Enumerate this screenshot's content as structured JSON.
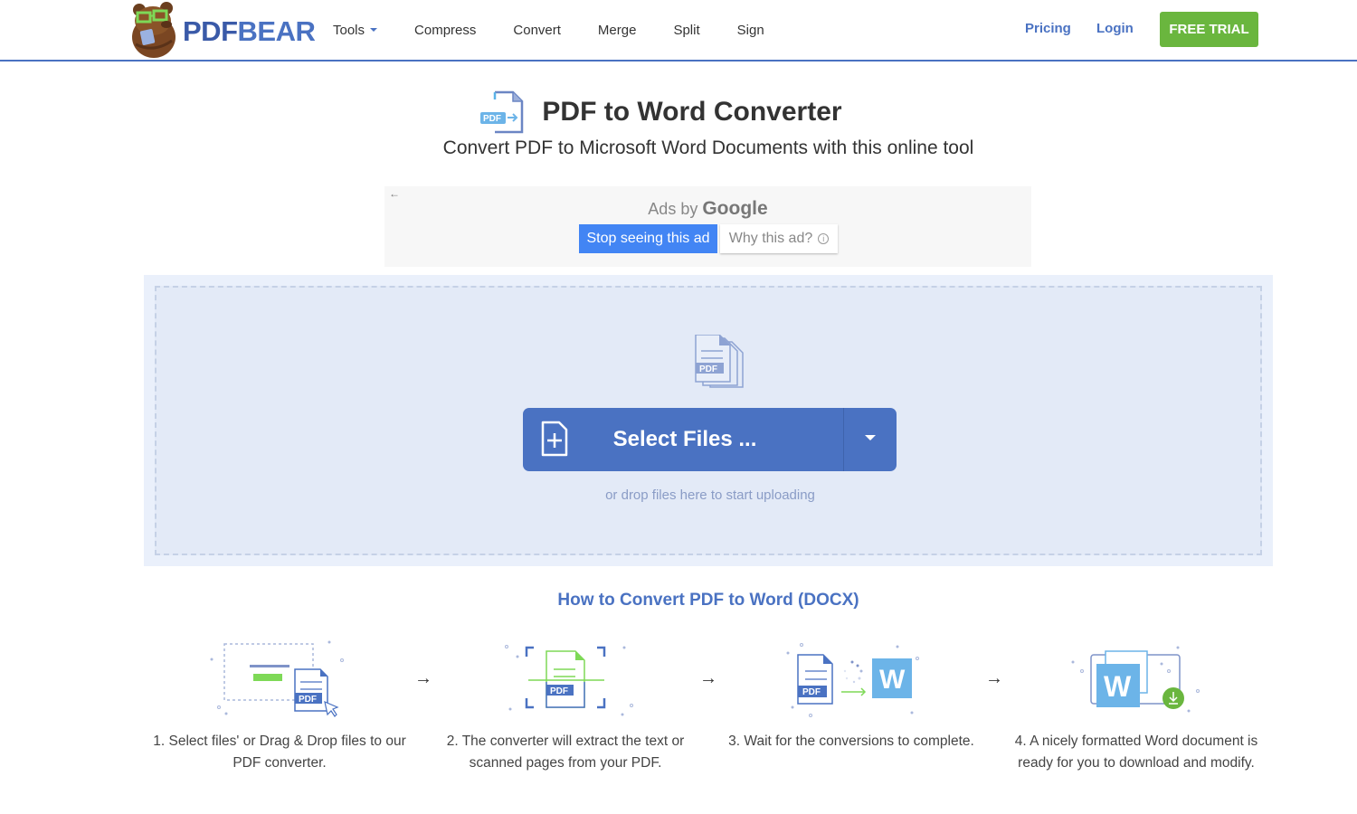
{
  "header": {
    "logo": {
      "part1": "PDF",
      "part2": "BEAR",
      "mascot": "bear-mascot"
    },
    "nav": [
      {
        "label": "Tools",
        "has_dropdown": true
      },
      {
        "label": "Compress"
      },
      {
        "label": "Convert"
      },
      {
        "label": "Merge"
      },
      {
        "label": "Split"
      },
      {
        "label": "Sign"
      }
    ],
    "pricing_label": "Pricing",
    "login_label": "Login",
    "trial_label": "FREE TRIAL"
  },
  "hero": {
    "title": "PDF to Word Converter",
    "subtitle": "Convert PDF to Microsoft Word Documents with this online tool",
    "icon_badge": "PDF"
  },
  "ad": {
    "back_arrow": "←",
    "ads_by": "Ads by",
    "google": "Google",
    "stop_label": "Stop seeing this ad",
    "why_label": "Why this ad?",
    "info_glyph": "i"
  },
  "upload": {
    "files_badge": "PDF",
    "select_label": "Select Files ...",
    "drop_hint": "or drop files here to start uploading"
  },
  "howto": {
    "title": "How to Convert PDF to Word (DOCX)",
    "arrow_glyph": "→",
    "steps": [
      {
        "text": "1. Select files' or Drag & Drop files to our PDF converter.",
        "badge": "PDF"
      },
      {
        "text": "2. The converter will extract the text or scanned pages from your PDF.",
        "badge": "PDF"
      },
      {
        "text": "3. Wait for the conversions to complete.",
        "badge": "PDF",
        "word": "W"
      },
      {
        "text": "4. A nicely formatted Word document is ready for you to download and modify.",
        "word": "W"
      }
    ]
  },
  "colors": {
    "brand_blue": "#4a72c2",
    "trial_green": "#6ab63e",
    "ad_blue": "#4285f4",
    "upload_bg": "#e3eaf7",
    "word_blue": "#6cb4e8"
  }
}
